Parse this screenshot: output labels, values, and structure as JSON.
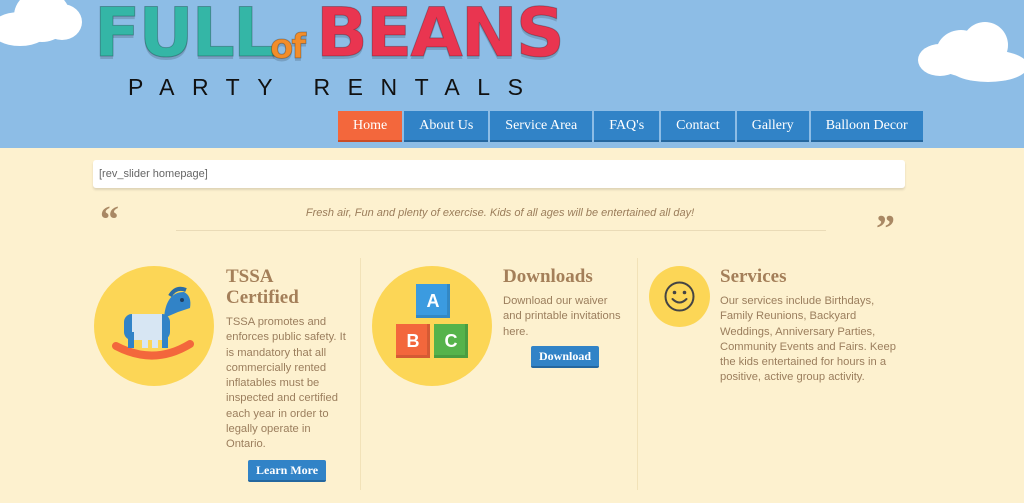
{
  "header": {
    "logo": {
      "words": [
        {
          "text": "FULL",
          "color": "#31b7a4"
        },
        {
          "text": "of",
          "color": "#f58a2a"
        },
        {
          "text": "BEANS",
          "color": "#e8334c"
        }
      ],
      "tagline": "PARTY RENTALS"
    },
    "nav": [
      {
        "label": "Home",
        "active": true
      },
      {
        "label": "About Us",
        "active": false
      },
      {
        "label": "Service Area",
        "active": false
      },
      {
        "label": "FAQ's",
        "active": false
      },
      {
        "label": "Contact",
        "active": false
      },
      {
        "label": "Gallery",
        "active": false
      },
      {
        "label": "Balloon Decor",
        "active": false
      }
    ],
    "colors": {
      "sky": "#8dbde6",
      "nav": "#3183c7",
      "nav_active": "#f3673c"
    }
  },
  "slider": {
    "placeholder": "[rev_slider homepage]"
  },
  "quote": {
    "open": "“",
    "close": "”",
    "text": "Fresh air, Fun and plenty of exercise. Kids of all ages will be entertained all day!"
  },
  "features": [
    {
      "icon": "rocking-horse-icon",
      "title": "TSSA Certified",
      "text": "TSSA promotes and enforces public safety. It is mandatory that all commercially rented inflatables must be inspected and certified each year in order to legally operate in Ontario.",
      "button": "Learn More"
    },
    {
      "icon": "abc-blocks-icon",
      "title": "Downloads",
      "text": "Download our waiver and printable invitations here.",
      "button": "Download",
      "blocks": [
        "A",
        "B",
        "C"
      ]
    },
    {
      "icon": "smiley-icon",
      "title": "Services",
      "text": "Our services include Birthdays, Family Reunions, Backyard Weddings, Anniversary Parties, Community Events and Fairs. Keep the kids entertained for hours in a positive, active group activity."
    }
  ]
}
